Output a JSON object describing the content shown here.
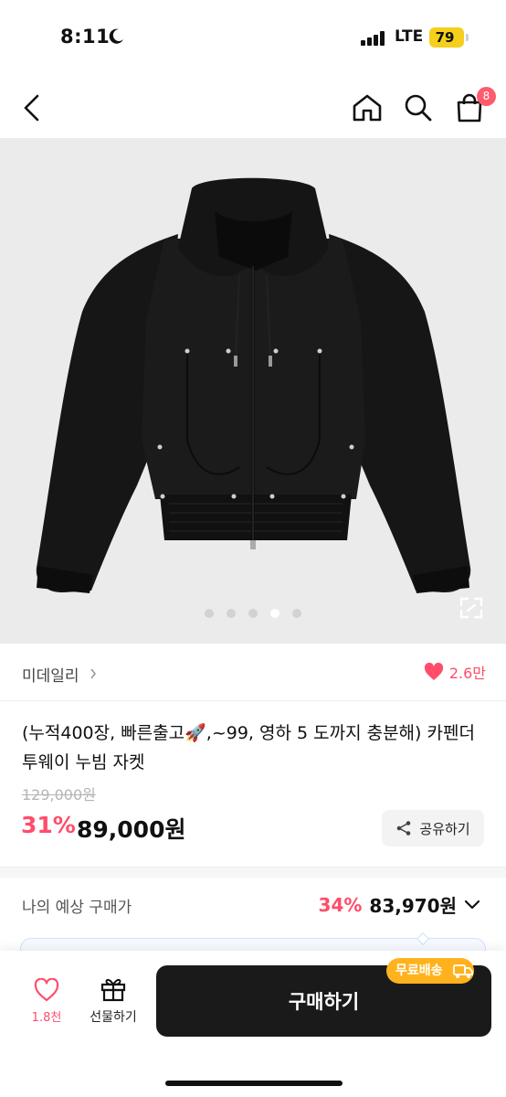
{
  "status_bar": {
    "time": "8:11",
    "network": "LTE",
    "battery": "79"
  },
  "nav": {
    "cart_count": "8",
    "icons": [
      "back-chevron-icon",
      "home-icon",
      "search-icon",
      "shopping-bag-icon"
    ]
  },
  "product_image": {
    "alt": "black hooded zip-up jacket",
    "dot_count": 5,
    "active_dot": 3
  },
  "brand": {
    "name": "미데일리",
    "like_count": "2.6만"
  },
  "product": {
    "title": "(누적400장, 빠른출고🚀,~99,  영하 5 도까지 충분해) 카펜더 투웨이 누빔 자켓",
    "original_price": "129,000원",
    "discount": "31%",
    "price": "89,000원",
    "share_label": "공유하기"
  },
  "expected_price": {
    "label": "나의 예상 구매가",
    "discount": "34%",
    "price": "83,970원"
  },
  "bottom_bar": {
    "like_count": "1.8천",
    "gift_label": "선물하기",
    "buy_label": "구매하기",
    "free_shipping_label": "무료배송"
  },
  "colors": {
    "accent": "#ff4d6a",
    "buy_button": "#1a1a1a",
    "free_shipping": "#ffb21d",
    "battery": "#f5cf1c"
  }
}
